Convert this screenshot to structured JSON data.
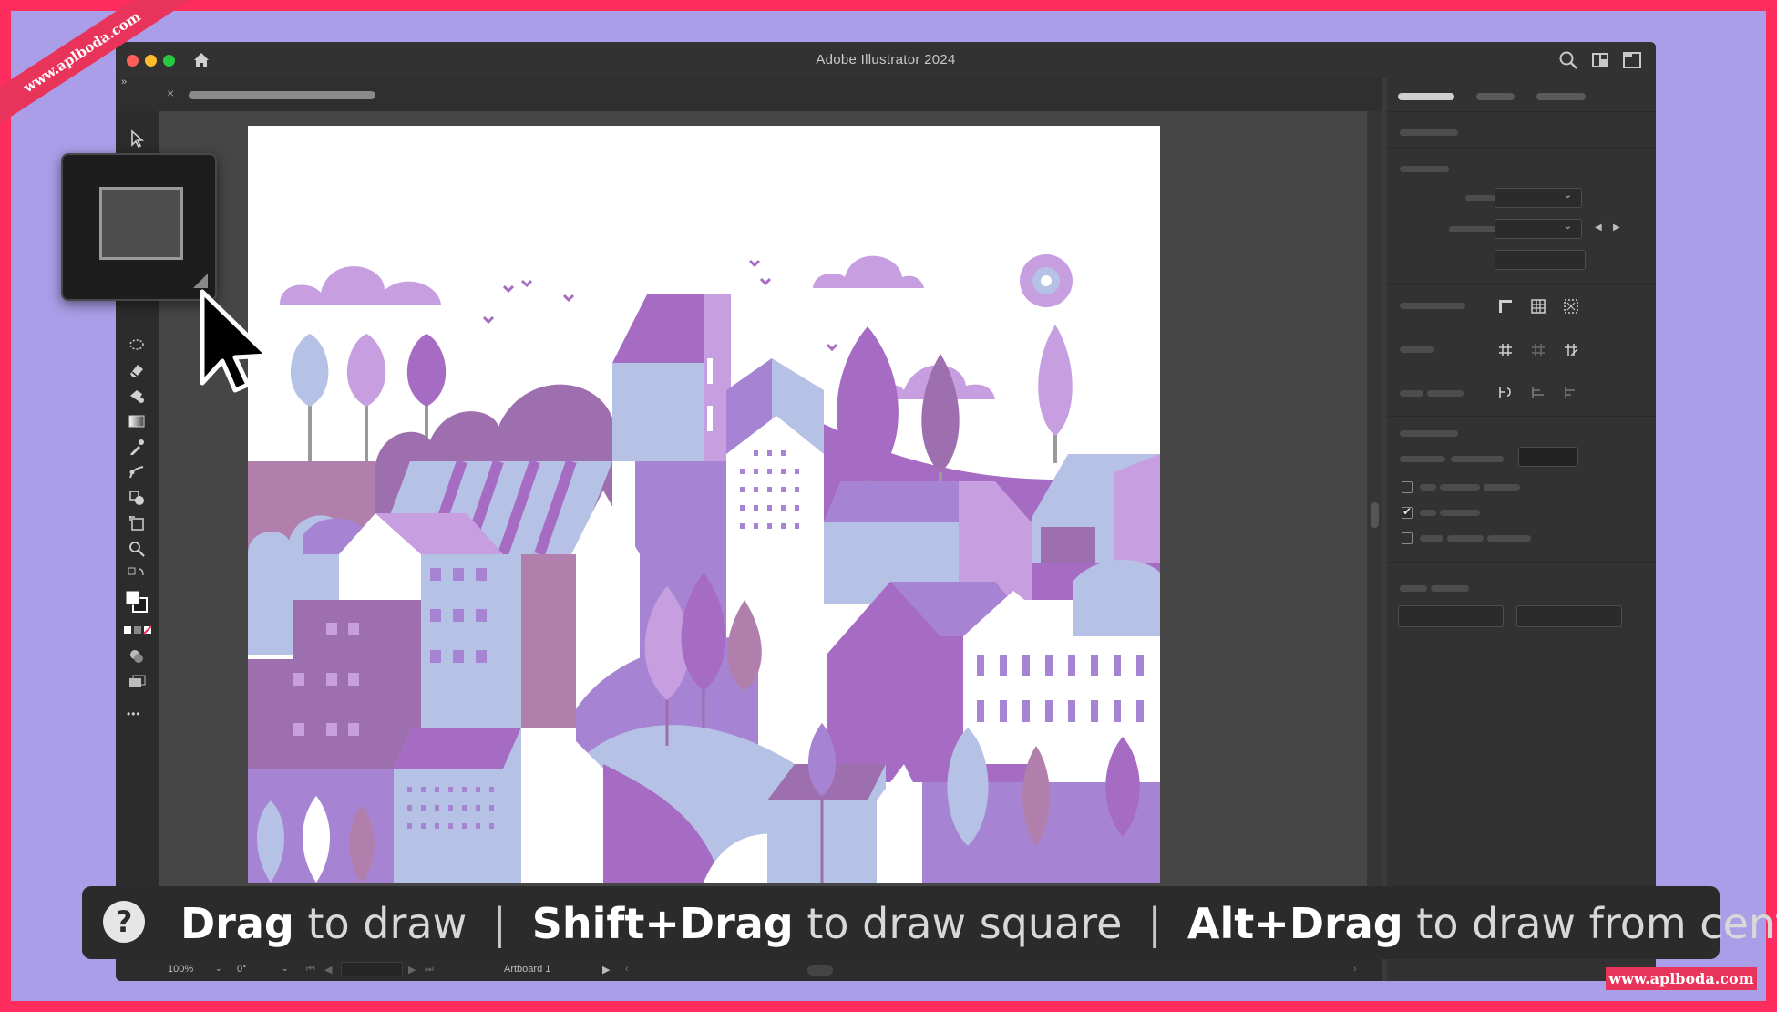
{
  "app": {
    "title": "Adobe Illustrator 2024"
  },
  "watermark": {
    "corner": "www.aplboda.com",
    "bottom": "www.aplboda.com"
  },
  "tab": {
    "close": "×"
  },
  "toolbar": {
    "collapse": "»",
    "more": "•••",
    "tools": [
      "selection-tool",
      "direct-selection-tool",
      "lasso-tool",
      "eraser-tool",
      "shaper-tool",
      "gradient-tool",
      "eyedropper-tool",
      "blend-tool",
      "shape-builder-tool",
      "artboard-tool",
      "zoom-tool"
    ]
  },
  "status": {
    "zoom": "100%",
    "rotation": "0°",
    "artboard": "Artboard 1"
  },
  "hint": {
    "help": "?",
    "items": [
      {
        "key": "Drag",
        "action": " to draw"
      },
      {
        "key": "Shift+Drag",
        "action": " to draw square"
      },
      {
        "key": "Alt+Drag",
        "action": " to draw from center"
      }
    ],
    "separator": "|"
  },
  "colors": {
    "frame": "#ff2d5e",
    "background": "#ab9ee8",
    "accent": "#e8345a"
  }
}
